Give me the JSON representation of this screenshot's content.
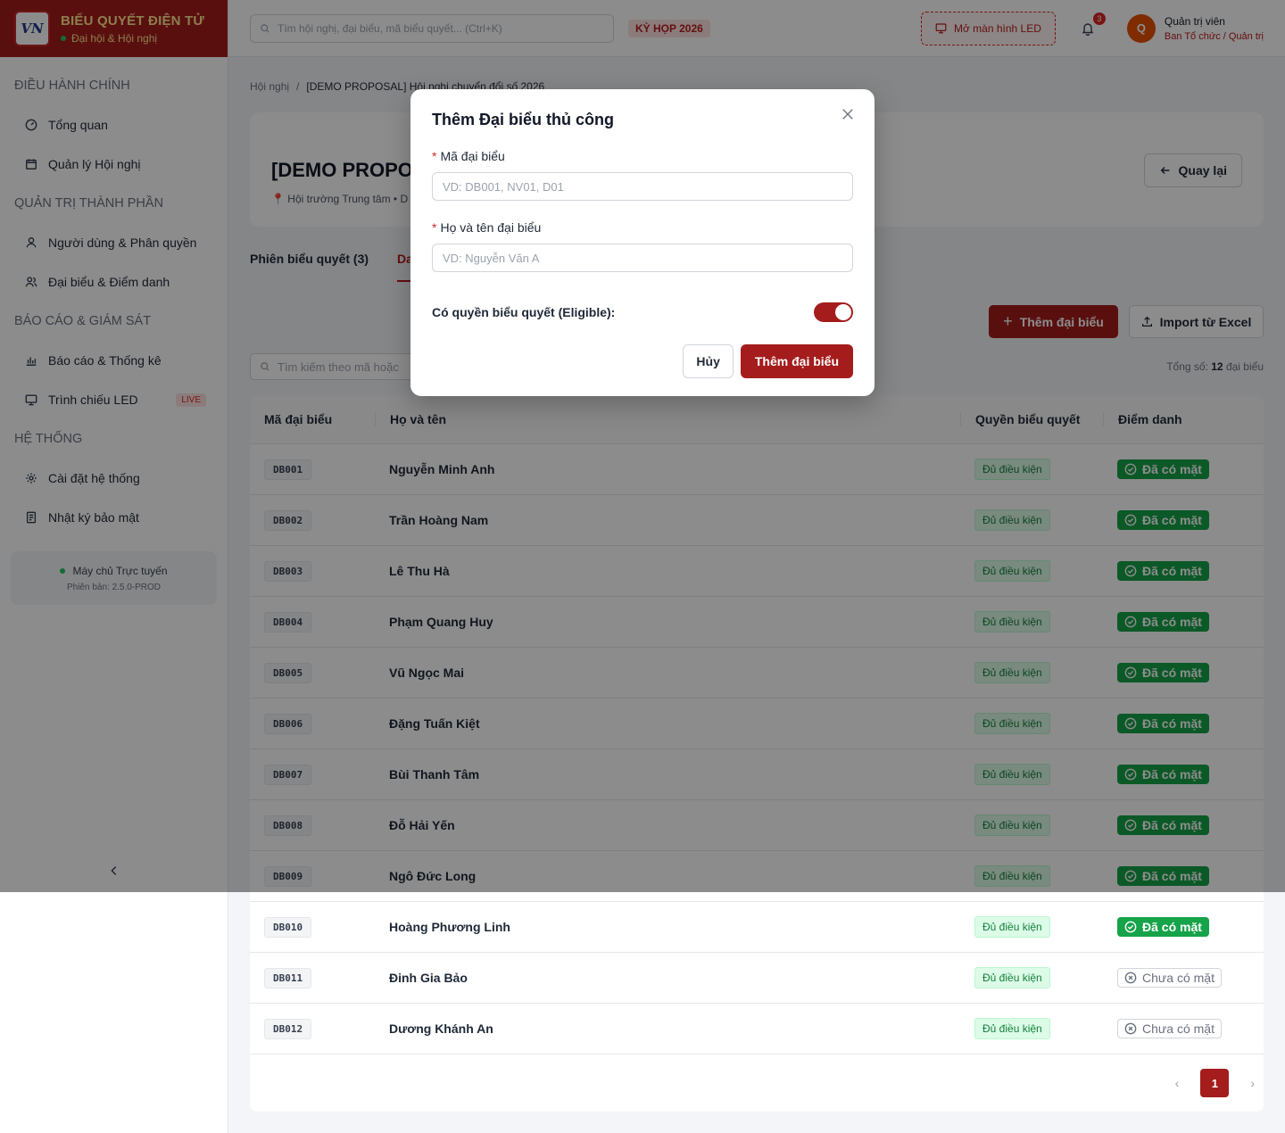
{
  "brand": {
    "logo_text": "VN",
    "title": "BIỂU QUYẾT ĐIỆN TỬ",
    "subtitle": "Đại hội & Hội nghị"
  },
  "sidebar": {
    "sections": [
      {
        "title": "ĐIỀU HÀNH CHÍNH",
        "items": [
          {
            "label": "Tổng quan",
            "icon": "dashboard-icon"
          },
          {
            "label": "Quản lý Hội nghị",
            "icon": "calendar-icon"
          }
        ]
      },
      {
        "title": "QUẢN TRỊ THÀNH PHẦN",
        "items": [
          {
            "label": "Người dùng & Phân quyền",
            "icon": "user-icon"
          },
          {
            "label": "Đại biểu & Điểm danh",
            "icon": "users-icon"
          }
        ]
      },
      {
        "title": "BÁO CÁO & GIÁM SÁT",
        "items": [
          {
            "label": "Báo cáo & Thống kê",
            "icon": "bar-chart-icon"
          },
          {
            "label": "Trình chiếu LED",
            "icon": "monitor-icon",
            "badge": "LIVE"
          }
        ]
      },
      {
        "title": "HỆ THỐNG",
        "items": [
          {
            "label": "Cài đặt hệ thống",
            "icon": "gear-icon"
          },
          {
            "label": "Nhật ký bảo mật",
            "icon": "log-icon"
          }
        ]
      }
    ],
    "server_status": "Máy chủ Trực tuyến",
    "version": "Phiên bản: 2.5.0-PROD",
    "collapse_icon": "chevron-left-icon"
  },
  "header": {
    "search_placeholder": "Tìm hội nghị, đại biểu, mã biểu quyết... (Ctrl+K)",
    "session_tag": "KỲ HỌP 2026",
    "led_button": "Mở màn hình LED",
    "notification_count": "3",
    "user_initial": "Q",
    "user_name": "Quản trị viên",
    "user_role": "Ban Tổ chức / Quản trị"
  },
  "breadcrumb": {
    "root": "Hội nghị",
    "separator": "/",
    "current": "[DEMO PROPOSAL] Hội nghị chuyển đổi số 2026"
  },
  "conference": {
    "title": "[DEMO PROPO",
    "location": "Hội trường Trung tâm • D",
    "back_label": "Quay lại"
  },
  "tabs": [
    {
      "label": "Phiên biểu quyết (3)"
    },
    {
      "label": "Da"
    }
  ],
  "toolbar": {
    "add_label": "Thêm đại biểu",
    "import_label": "Import từ Excel",
    "search_placeholder": "Tìm kiếm theo mã hoặc",
    "total_prefix": "Tổng số:",
    "total_count": "12",
    "total_suffix": "đại biểu"
  },
  "table": {
    "columns": [
      "Mã đại biểu",
      "Họ và tên",
      "Quyền biểu quyết",
      "Điểm danh"
    ],
    "rows": [
      {
        "code": "DB001",
        "name": "Nguyễn Minh Anh",
        "eligibility": "Đủ điều kiện",
        "attendance": "Đã có mặt",
        "present": true
      },
      {
        "code": "DB002",
        "name": "Trần Hoàng Nam",
        "eligibility": "Đủ điều kiện",
        "attendance": "Đã có mặt",
        "present": true
      },
      {
        "code": "DB003",
        "name": "Lê Thu Hà",
        "eligibility": "Đủ điều kiện",
        "attendance": "Đã có mặt",
        "present": true
      },
      {
        "code": "DB004",
        "name": "Phạm Quang Huy",
        "eligibility": "Đủ điều kiện",
        "attendance": "Đã có mặt",
        "present": true
      },
      {
        "code": "DB005",
        "name": "Vũ Ngọc Mai",
        "eligibility": "Đủ điều kiện",
        "attendance": "Đã có mặt",
        "present": true
      },
      {
        "code": "DB006",
        "name": "Đặng Tuấn Kiệt",
        "eligibility": "Đủ điều kiện",
        "attendance": "Đã có mặt",
        "present": true
      },
      {
        "code": "DB007",
        "name": "Bùi Thanh Tâm",
        "eligibility": "Đủ điều kiện",
        "attendance": "Đã có mặt",
        "present": true
      },
      {
        "code": "DB008",
        "name": "Đỗ Hải Yến",
        "eligibility": "Đủ điều kiện",
        "attendance": "Đã có mặt",
        "present": true
      },
      {
        "code": "DB009",
        "name": "Ngô Đức Long",
        "eligibility": "Đủ điều kiện",
        "attendance": "Đã có mặt",
        "present": true
      },
      {
        "code": "DB010",
        "name": "Hoàng Phương Linh",
        "eligibility": "Đủ điều kiện",
        "attendance": "Đã có mặt",
        "present": true
      },
      {
        "code": "DB011",
        "name": "Đinh Gia Bảo",
        "eligibility": "Đủ điều kiện",
        "attendance": "Chưa có mặt",
        "present": false
      },
      {
        "code": "DB012",
        "name": "Dương Khánh An",
        "eligibility": "Đủ điều kiện",
        "attendance": "Chưa có mặt",
        "present": false
      }
    ]
  },
  "pagination": {
    "prev": "‹",
    "current": "1",
    "next": "›"
  },
  "modal": {
    "title": "Thêm Đại biểu thủ công",
    "close": "×",
    "code_label": "Mã đại biểu",
    "code_placeholder": "VD: DB001, NV01, D01",
    "code_value": "",
    "name_label": "Họ và tên đại biểu",
    "name_placeholder": "VD: Nguyễn Văn A",
    "name_value": "",
    "required_mark": "*",
    "eligible_label": "Có quyền biểu quyết (Eligible):",
    "eligible_on": true,
    "cancel_label": "Hủy",
    "submit_label": "Thêm đại biểu"
  },
  "colors": {
    "brand": "#a51c1c",
    "present": "#16a34a",
    "eligible_bg": "#dcfce7"
  }
}
